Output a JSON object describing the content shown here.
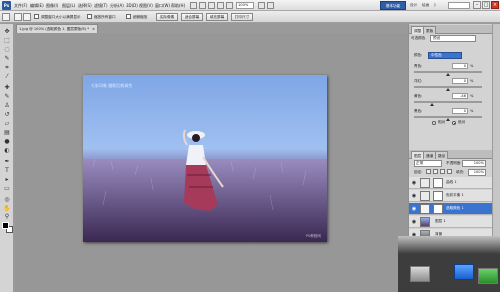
{
  "menubar": {
    "logo": "Ps",
    "menus": [
      "文件(F)",
      "编辑(E)",
      "图像(I)",
      "图层(L)",
      "选择(S)",
      "滤镜(T)",
      "分析(A)",
      "3D(D)",
      "视图(V)",
      "窗口(W)",
      "帮助(H)"
    ],
    "zoom": "100%",
    "workspace": "基本功能",
    "workspace_links": [
      "设计",
      "绘画",
      "》"
    ]
  },
  "options_bar": {
    "checkbox1_label": "调整窗口大小以满屏显示",
    "checkbox2_label": "缩放所有窗口",
    "checkbox3_label": "细微缩放",
    "buttons": [
      "实际像素",
      "适合屏幕",
      "填充屏幕",
      "打印尺寸"
    ]
  },
  "document": {
    "tab_title": "1.jpg @ 100% (选取颜色 1, 图层蒙版/8) *",
    "watermark": "七彩印象 摄影后期调色",
    "credit": "PS教程网"
  },
  "adjustments_panel": {
    "tabs": [
      "调整",
      "蒙版"
    ],
    "title": "可选颜色",
    "preset": "预设",
    "colors_label": "颜色:",
    "colors_value": "中性色",
    "sliders": [
      {
        "label": "青色:",
        "value": "0"
      },
      {
        "label": "洋红:",
        "value": "0"
      },
      {
        "label": "黄色:",
        "value": "-46"
      },
      {
        "label": "黑色:",
        "value": "0"
      }
    ],
    "pct": "%",
    "mode_options": [
      "相对",
      "绝对"
    ],
    "mode_selected": "绝对"
  },
  "layers_panel": {
    "tabs": [
      "图层",
      "通道",
      "路径"
    ],
    "blend_mode": "正常",
    "opacity_label": "不透明度:",
    "opacity_value": "100%",
    "lock_label": "锁定:",
    "fill_label": "填充:",
    "fill_value": "100%",
    "layers": [
      {
        "name": "曲线 1",
        "selected": false
      },
      {
        "name": "色彩平衡 1",
        "selected": false
      },
      {
        "name": "选取颜色 1",
        "selected": true
      },
      {
        "name": "图层 1",
        "selected": false
      },
      {
        "name": "背景",
        "selected": false
      }
    ]
  },
  "colors": {
    "accent": "#3a74cf",
    "workspace": "#2f5ea8",
    "close": "#c63a2c"
  }
}
